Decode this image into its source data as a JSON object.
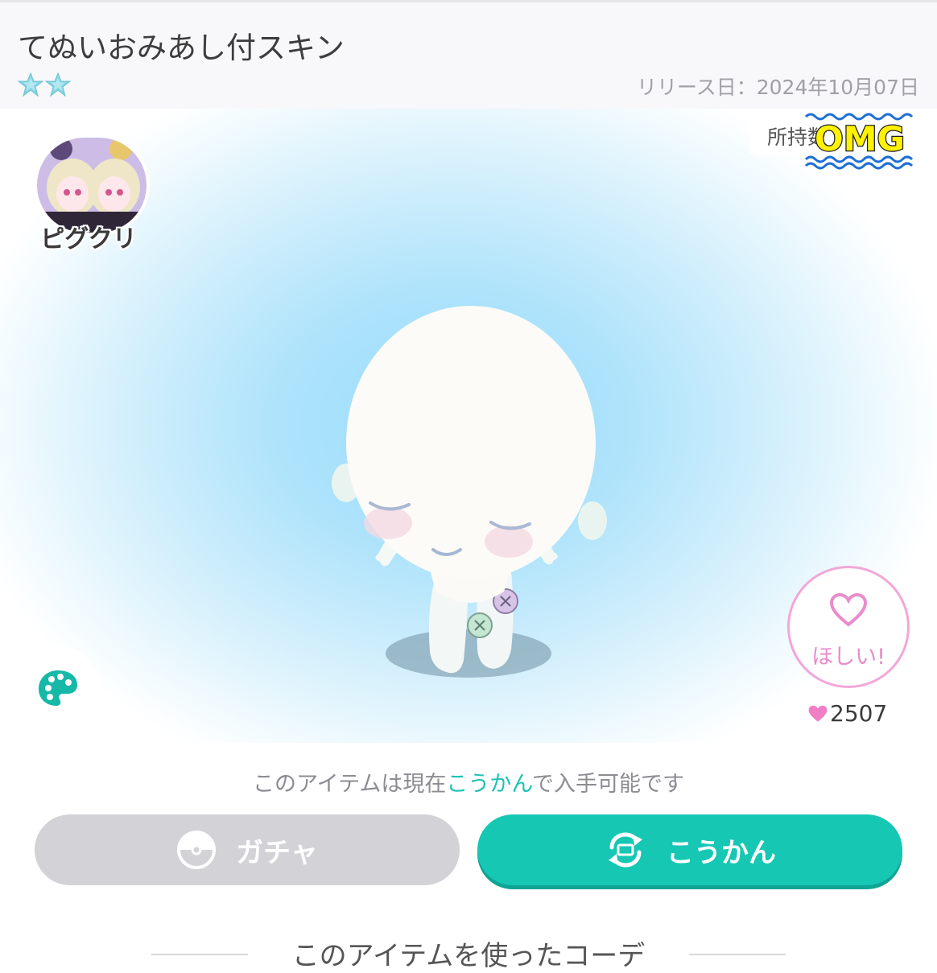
{
  "header": {
    "title": "てぬいおみあし付スキン",
    "rarity": {
      "stars": 2,
      "star_color": "#7ecfe0",
      "icon": "star-icon"
    },
    "release_date": "リリース日：2024年10月07日"
  },
  "stage": {
    "creator": {
      "name": "ピグクリ",
      "icon": "creator-avatar"
    },
    "owned_label": "所持数",
    "sticker_text": "OMG",
    "want_button": {
      "label": "ほしい!",
      "icon": "heart-outline-icon",
      "color": "#e98ccc"
    },
    "like_count": "2507",
    "palette_icon": "palette-icon",
    "accent": "#16c7b4"
  },
  "availability": {
    "prefix": "このアイテムは現在",
    "highlight": "こうかん",
    "suffix": "で入手可能です"
  },
  "actions": {
    "gacha_label": "ガチャ",
    "gacha_icon": "gacha-capsule-icon",
    "exchange_label": "こうかん",
    "exchange_icon": "exchange-icon"
  },
  "section": {
    "heading": "このアイテムを使ったコーデ"
  }
}
